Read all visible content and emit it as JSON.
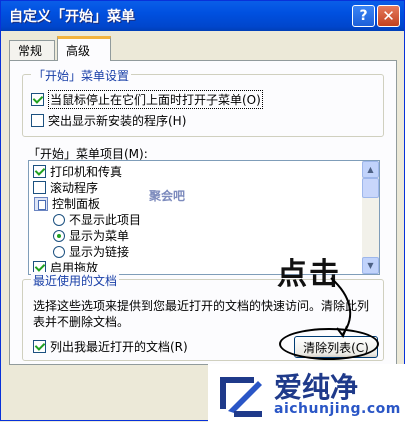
{
  "window": {
    "title": "自定义「开始」菜单",
    "help_label": "?",
    "close_label": "✕"
  },
  "tabs": [
    {
      "label": "常规"
    },
    {
      "label": "高级"
    }
  ],
  "start_menu_settings": {
    "legend": "「开始」菜单设置",
    "open_submenus_on_hover": {
      "label": "当鼠标停止在它们上面时打开子菜单(O)",
      "checked": true
    },
    "highlight_new_programs": {
      "label": "突出显示新安装的程序(H)",
      "checked": false
    }
  },
  "start_menu_items": {
    "label": "「开始」菜单项目(M):",
    "items": [
      {
        "label": "打印机和传真",
        "type": "checkbox",
        "checked": true
      },
      {
        "label": "滚动程序",
        "type": "checkbox",
        "checked": false
      },
      {
        "label": "控制面板",
        "type": "category"
      },
      {
        "label": "不显示此项目",
        "type": "radio",
        "selected": false
      },
      {
        "label": "显示为菜单",
        "type": "radio",
        "selected": true
      },
      {
        "label": "显示为链接",
        "type": "radio",
        "selected": false
      },
      {
        "label": "启用拖放",
        "type": "checkbox",
        "checked": true
      }
    ],
    "watermark": "聚会吧"
  },
  "recent_documents": {
    "legend": "最近使用的文档",
    "description": "选择这些选项来提供到您最近打开的文档的快速访问。清除此列表并不删除文档。",
    "list_recent": {
      "label": "列出我最近打开的文档(R)",
      "checked": true
    },
    "clear_button_label": "清除列表(C)"
  },
  "annotation": {
    "text": "点击"
  },
  "watermark_logo": {
    "name": "爱纯净",
    "url": "aichunjing.com"
  },
  "colors": {
    "titlebar": "#0050e0",
    "accent_tab": "#f3b33d",
    "legend_text": "#1a40a8"
  }
}
